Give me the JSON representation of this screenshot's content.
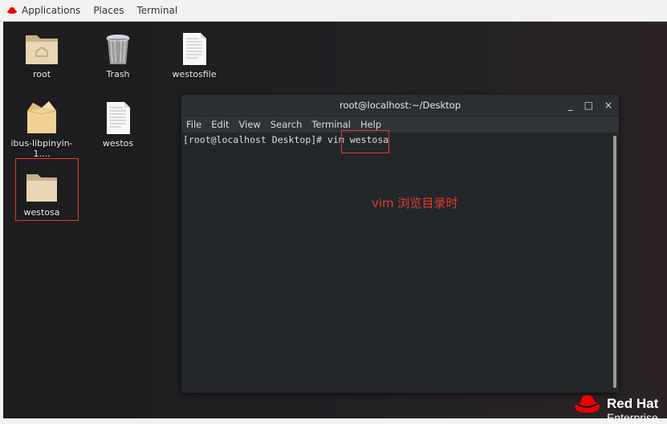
{
  "topbar": {
    "items": [
      {
        "label": "Applications",
        "icon": "redhat-icon"
      },
      {
        "label": "Places"
      },
      {
        "label": "Terminal"
      }
    ]
  },
  "desktop": {
    "icons": [
      {
        "label": "root",
        "type": "home-folder-icon"
      },
      {
        "label": "Trash",
        "type": "trash-icon"
      },
      {
        "label": "westosfile",
        "type": "text-file-icon"
      },
      {
        "label": "ibus-libpinyin-1....",
        "type": "package-icon"
      },
      {
        "label": "westos",
        "type": "text-file-icon"
      },
      {
        "label": "westosa",
        "type": "folder-icon",
        "highlighted": true
      }
    ]
  },
  "terminal": {
    "title": "root@localhost:~/Desktop",
    "window_buttons": {
      "minimize": "_",
      "maximize": "□",
      "close": "×"
    },
    "menu": [
      "File",
      "Edit",
      "View",
      "Search",
      "Terminal",
      "Help"
    ],
    "prompt": "[root@localhost Desktop]# vim ",
    "argument": "westosa"
  },
  "annotation": "vim 浏览目录时",
  "branding": {
    "name": "Red Hat",
    "subtitle": "Enterprise"
  },
  "colors": {
    "annotation_red": "#e5392f",
    "redhat_red": "#ee0000"
  }
}
